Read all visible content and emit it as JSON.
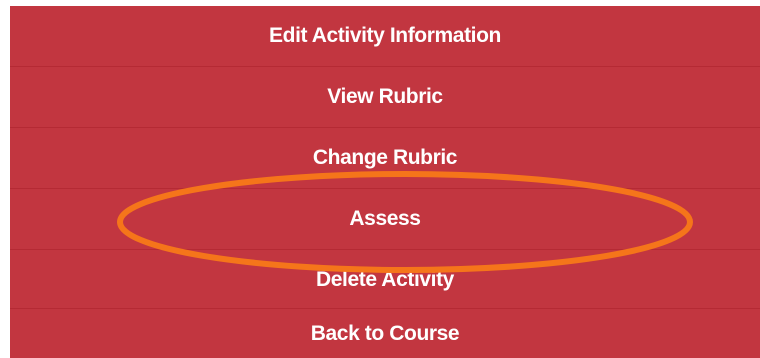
{
  "menu": {
    "items": [
      {
        "label": "Edit Activity Information"
      },
      {
        "label": "View Rubric"
      },
      {
        "label": "Change Rubric"
      },
      {
        "label": "Assess"
      },
      {
        "label": "Delete Activity"
      },
      {
        "label": "Back to Course"
      }
    ]
  },
  "colors": {
    "menu_background": "#c23640",
    "menu_text": "#ffffff",
    "highlight_ellipse": "#f5751a"
  }
}
